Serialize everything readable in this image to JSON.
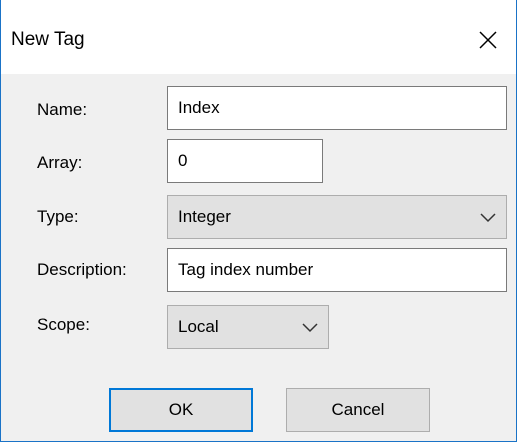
{
  "dialog": {
    "title": "New Tag",
    "close_icon": "close-icon"
  },
  "fields": {
    "name": {
      "label": "Name:",
      "value": "Index"
    },
    "array": {
      "label": "Array:",
      "value": "0"
    },
    "type": {
      "label": "Type:",
      "value": "Integer"
    },
    "description": {
      "label": "Description:",
      "value": "Tag index number"
    },
    "scope": {
      "label": "Scope:",
      "value": "Local"
    }
  },
  "buttons": {
    "ok": "OK",
    "cancel": "Cancel"
  },
  "colors": {
    "accent": "#0078d7",
    "window_border": "#1a73c7",
    "dialog_bg": "#f0f0f0"
  }
}
